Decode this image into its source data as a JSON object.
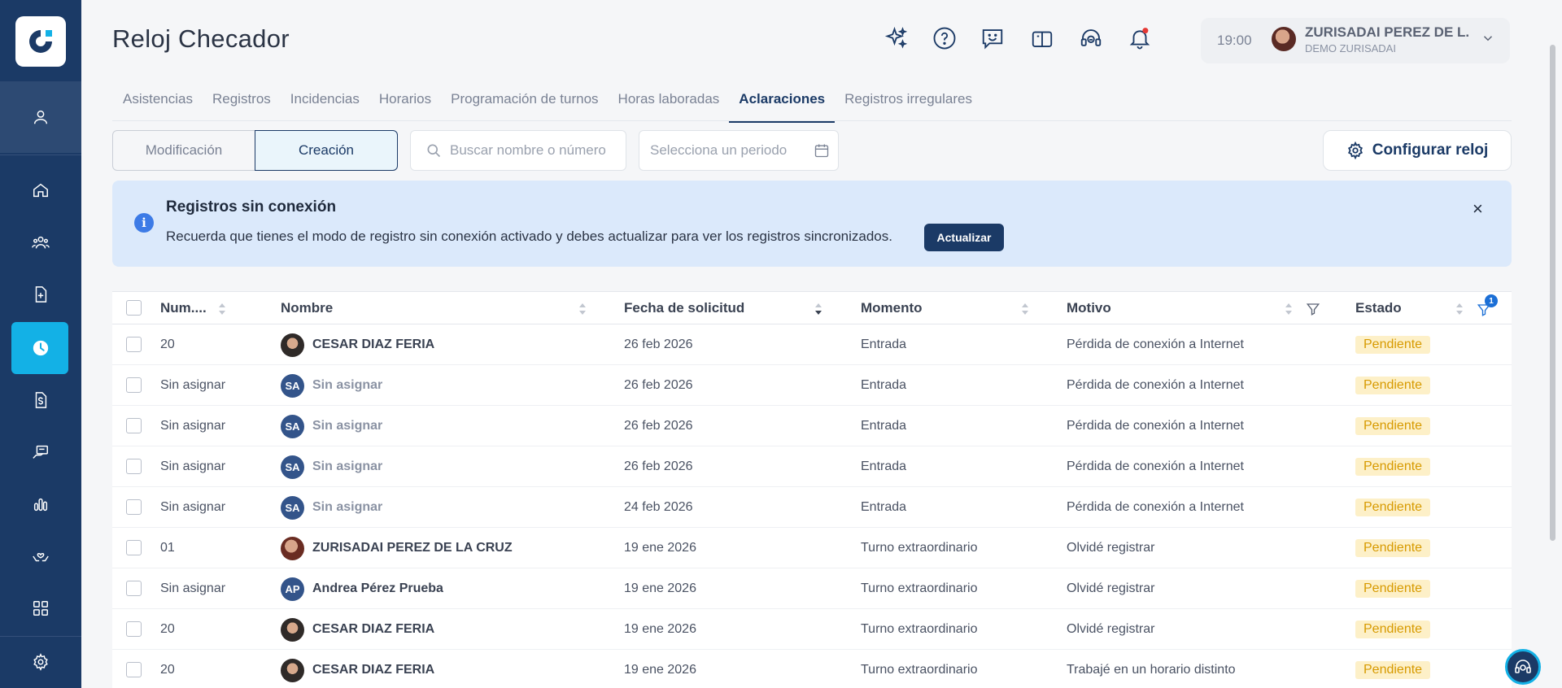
{
  "app": {
    "title": "Reloj Checador"
  },
  "sidebar": {
    "items": [
      {
        "name": "home",
        "icon": "home-icon"
      },
      {
        "name": "employees",
        "icon": "users-icon"
      },
      {
        "name": "documents",
        "icon": "document-plus-icon"
      },
      {
        "name": "clock",
        "icon": "clock-icon",
        "active": true
      },
      {
        "name": "payroll",
        "icon": "dollar-document-icon"
      },
      {
        "name": "reports",
        "icon": "hand-card-icon"
      },
      {
        "name": "analytics",
        "icon": "bar-chart-icon"
      },
      {
        "name": "benefits",
        "icon": "hands-heart-icon"
      },
      {
        "name": "apps",
        "icon": "grid-icon"
      },
      {
        "name": "settings",
        "icon": "gear-icon"
      }
    ]
  },
  "header": {
    "time": "19:00",
    "user_name": "ZURISADAI PEREZ DE L...",
    "user_company": "DEMO ZURISADAI"
  },
  "tabs": [
    {
      "label": "Asistencias"
    },
    {
      "label": "Registros"
    },
    {
      "label": "Incidencias"
    },
    {
      "label": "Horarios"
    },
    {
      "label": "Programación de turnos"
    },
    {
      "label": "Horas laboradas"
    },
    {
      "label": "Aclaraciones",
      "active": true
    },
    {
      "label": "Registros irregulares"
    }
  ],
  "toolbar": {
    "seg_modificacion": "Modificación",
    "seg_creacion": "Creación",
    "search_placeholder": "Buscar nombre o número",
    "period_placeholder": "Selecciona un periodo",
    "config_label": "Configurar reloj"
  },
  "alert": {
    "title": "Registros sin conexión",
    "text": "Recuerda que tienes el modo de registro sin conexión activado y debes actualizar para ver los registros sincronizados.",
    "button": "Actualizar",
    "close": "×"
  },
  "table": {
    "headers": {
      "num": "Num....",
      "nombre": "Nombre",
      "fecha": "Fecha de solicitud",
      "momento": "Momento",
      "motivo": "Motivo",
      "estado": "Estado",
      "filter_count": "1"
    },
    "rows": [
      {
        "num": "20",
        "avatar": "photo-man",
        "initials": "",
        "nombre": "CESAR DIAZ FERIA",
        "fecha": "26 feb 2026",
        "momento": "Entrada",
        "motivo": "Pérdida de conexión a Internet",
        "estado": "Pendiente",
        "assigned": true
      },
      {
        "num": "Sin asignar",
        "avatar": "initials",
        "initials": "SA",
        "nombre": "Sin asignar",
        "fecha": "26 feb 2026",
        "momento": "Entrada",
        "motivo": "Pérdida de conexión a Internet",
        "estado": "Pendiente",
        "assigned": false
      },
      {
        "num": "Sin asignar",
        "avatar": "initials",
        "initials": "SA",
        "nombre": "Sin asignar",
        "fecha": "26 feb 2026",
        "momento": "Entrada",
        "motivo": "Pérdida de conexión a Internet",
        "estado": "Pendiente",
        "assigned": false
      },
      {
        "num": "Sin asignar",
        "avatar": "initials",
        "initials": "SA",
        "nombre": "Sin asignar",
        "fecha": "26 feb 2026",
        "momento": "Entrada",
        "motivo": "Pérdida de conexión a Internet",
        "estado": "Pendiente",
        "assigned": false
      },
      {
        "num": "Sin asignar",
        "avatar": "initials",
        "initials": "SA",
        "nombre": "Sin asignar",
        "fecha": "24 feb 2026",
        "momento": "Entrada",
        "motivo": "Pérdida de conexión a Internet",
        "estado": "Pendiente",
        "assigned": false
      },
      {
        "num": "01",
        "avatar": "photo-woman",
        "initials": "",
        "nombre": "ZURISADAI PEREZ DE LA CRUZ",
        "fecha": "19 ene 2026",
        "momento": "Turno extraordinario",
        "motivo": "Olvidé registrar",
        "estado": "Pendiente",
        "assigned": true
      },
      {
        "num": "Sin asignar",
        "avatar": "initials",
        "initials": "AP",
        "nombre": "Andrea Pérez Prueba",
        "fecha": "19 ene 2026",
        "momento": "Turno extraordinario",
        "motivo": "Olvidé registrar",
        "estado": "Pendiente",
        "assigned": true
      },
      {
        "num": "20",
        "avatar": "photo-man",
        "initials": "",
        "nombre": "CESAR DIAZ FERIA",
        "fecha": "19 ene 2026",
        "momento": "Turno extraordinario",
        "motivo": "Olvidé registrar",
        "estado": "Pendiente",
        "assigned": true
      },
      {
        "num": "20",
        "avatar": "photo-man",
        "initials": "",
        "nombre": "CESAR DIAZ FERIA",
        "fecha": "19 ene 2026",
        "momento": "Turno extraordinario",
        "motivo": "Trabajé en un horario distinto",
        "estado": "Pendiente",
        "assigned": true
      }
    ]
  },
  "colors": {
    "sidebar": "#1b3a66",
    "accent": "#13b1e6",
    "primary": "#1b3a66",
    "alert_bg": "#dbe9fb",
    "badge_bg": "#fdf0c8",
    "badge_text": "#d79a00"
  }
}
